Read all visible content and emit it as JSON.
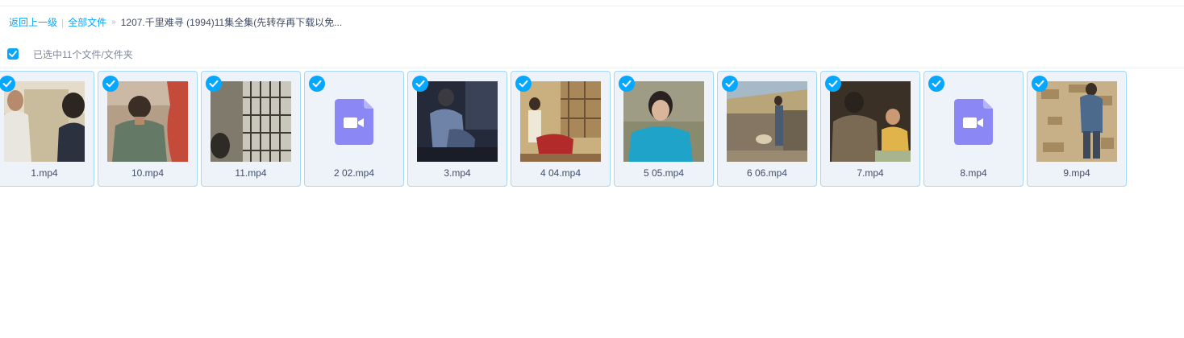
{
  "breadcrumb": {
    "back": "返回上一级",
    "all_files": "全部文件",
    "current": "1207.千里难寻 (1994)11集全集(先转存再下载以免..."
  },
  "selection": {
    "text": "已选中11个文件/文件夹",
    "all_checked": true
  },
  "files": [
    {
      "name": "1.mp4",
      "thumb": "scene-room-child"
    },
    {
      "name": "10.mp4",
      "thumb": "scene-green-boy"
    },
    {
      "name": "11.mp4",
      "thumb": "scene-lattice-window"
    },
    {
      "name": "2 02.mp4",
      "thumb": "video-file-icon"
    },
    {
      "name": "3.mp4",
      "thumb": "scene-dark-blue"
    },
    {
      "name": "4 04.mp4",
      "thumb": "scene-living-room"
    },
    {
      "name": "5 05.mp4",
      "thumb": "scene-blue-woman"
    },
    {
      "name": "6 06.mp4",
      "thumb": "scene-village"
    },
    {
      "name": "7.mp4",
      "thumb": "scene-dark-interior"
    },
    {
      "name": "8.mp4",
      "thumb": "video-file-icon"
    },
    {
      "name": "9.mp4",
      "thumb": "scene-clay-wall"
    }
  ],
  "colors": {
    "accent": "#06a7ff",
    "tile_border": "#a5d9f7",
    "tile_bg": "#eef3fa",
    "video_icon": "#8b87f5"
  }
}
